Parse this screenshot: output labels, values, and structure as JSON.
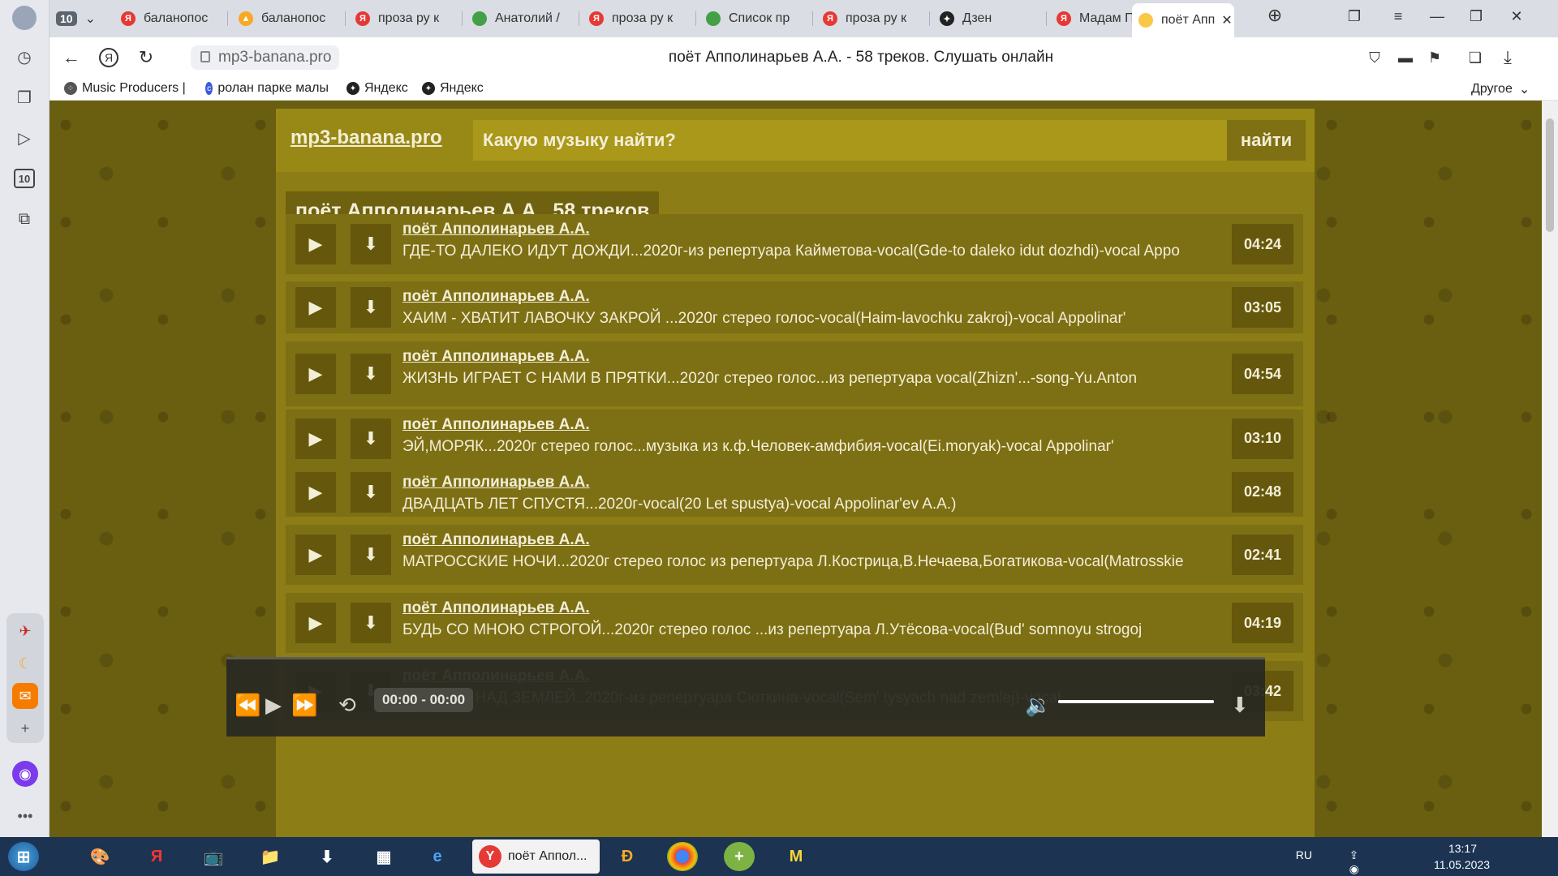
{
  "browser": {
    "tab_count": "10",
    "tabs": [
      {
        "label": "баланопос",
        "color": "#e53935",
        "glyph": "Я"
      },
      {
        "label": "баланопос",
        "color": "#f9a825",
        "glyph": "▲"
      },
      {
        "label": "проза ру к",
        "color": "#e53935",
        "glyph": "Я"
      },
      {
        "label": "Анатолий /",
        "color": "#43a047",
        "glyph": ""
      },
      {
        "label": "проза ру к",
        "color": "#e53935",
        "glyph": "Я"
      },
      {
        "label": "Список пр",
        "color": "#43a047",
        "glyph": ""
      },
      {
        "label": "проза ру к",
        "color": "#e53935",
        "glyph": "Я"
      },
      {
        "label": "Дзен",
        "color": "#222222",
        "glyph": "✦"
      },
      {
        "label": "Мадам По",
        "color": "#e53935",
        "glyph": "Я"
      },
      {
        "label": "поёт Апп",
        "color": "#f9c846",
        "glyph": ""
      }
    ],
    "url": "mp3-banana.pro",
    "page_title": "поёт Апполинарьев А.А. - 58 треков. Слушать онлайн",
    "bookmarks": [
      {
        "label": "Music Producers |"
      },
      {
        "label": "ролан парке малы"
      },
      {
        "label": "Яндекс"
      },
      {
        "label": "Яндекс"
      }
    ],
    "bookmarks_other": "Другое",
    "yandex_logo": "Я"
  },
  "site": {
    "logo": "mp3-banana.pro",
    "search_placeholder": "Какую музыку найти?",
    "search_button": "найти",
    "heading": "поёт Апполинарьев А.А.. 58 треков"
  },
  "tracks": [
    {
      "artist": "поёт Апполинарьев А.А.",
      "title": "ГДЕ-ТО ДАЛЕКО ИДУТ ДОЖДИ...2020г-из репертуара Кайметова-vocal(Gde-to daleko idut dozhdi)-vocal Appo",
      "duration": "04:24"
    },
    {
      "artist": "поёт Апполинарьев А.А.",
      "title": "ХАИМ - ХВАТИТ ЛАВОЧКУ ЗАКРОЙ ...2020г стерео голос-vocal(Haim-lavochku zakroj)-vocal Appolinar'",
      "duration": "03:05"
    },
    {
      "artist": "поёт Апполинарьев А.А.",
      "title": "ЖИЗНЬ ИГРАЕТ С НАМИ В ПРЯТКИ...2020г стерео голос...из репертуара vocal(Zhizn'...-song-Yu.Anton",
      "duration": "04:54"
    },
    {
      "artist": "поёт Апполинарьев А.А.",
      "title": "ЭЙ,МОРЯК...2020г стерео голос...музыка из к.ф.Человек-амфибия-vocal(Ei.moryak)-vocal Appolinar'",
      "duration": "03:10"
    },
    {
      "artist": "поёт Апполинарьев А.А.",
      "title": "ДВАДЦАТЬ ЛЕТ СПУСТЯ...2020г-vocal(20 Let spustya)-vocal Appolinar'ev A.A.)",
      "duration": "02:48"
    },
    {
      "artist": "поёт Апполинарьев А.А.",
      "title": "МАТРОССКИЕ НОЧИ...2020г стерео голос из репертуара Л.Кострица,В.Нечаева,Богатикова-vocal(Matrosskie",
      "duration": "02:41"
    },
    {
      "artist": "поёт Апполинарьев А.А.",
      "title": "БУДЬ СО МНОЮ СТРОГОЙ...2020г стерео голос ...из репертуара Л.Утёсова-vocal(Bud' somnoyu strogoj",
      "duration": "04:19"
    },
    {
      "artist": "поёт Апполинарьев А.А.",
      "title": "7 ТЫСЯЧ НАД ЗЕМЛЕЙ..2020г-из репертуара Сюткина-vocal(Sem' tysyach nad zemlej)-vocal",
      "duration": "03:42"
    }
  ],
  "player": {
    "time": "00:00 - 00:00",
    "volume_fraction": 1.0
  },
  "taskbar": {
    "active_window": "поёт Аппол...",
    "lang": "RU",
    "time": "13:17",
    "date": "11.05.2023"
  }
}
